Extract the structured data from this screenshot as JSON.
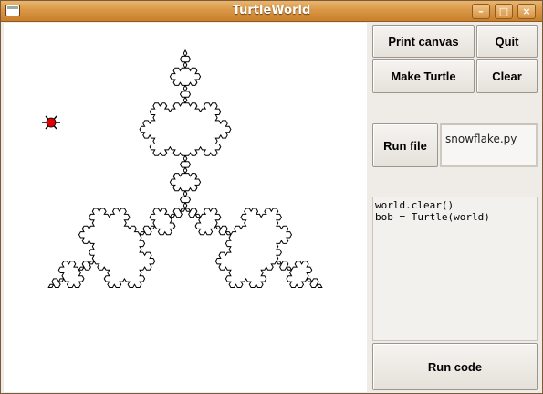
{
  "window": {
    "title": "TurtleWorld",
    "minimize": "–",
    "maximize": "□",
    "close": "×"
  },
  "buttons": {
    "print_canvas": "Print canvas",
    "quit": "Quit",
    "make_turtle": "Make Turtle",
    "clear": "Clear",
    "run_file": "Run file",
    "run_code": "Run code"
  },
  "file_field": {
    "value": "snowflake.py"
  },
  "code_editor": {
    "line1": "world.clear()",
    "line2": "bob = Turtle(world)"
  },
  "colors": {
    "titlebar": "#d99745",
    "turtle": "#e00000",
    "snowflake_line": "#000000"
  },
  "icons": {
    "turtle": "turtle-icon"
  }
}
